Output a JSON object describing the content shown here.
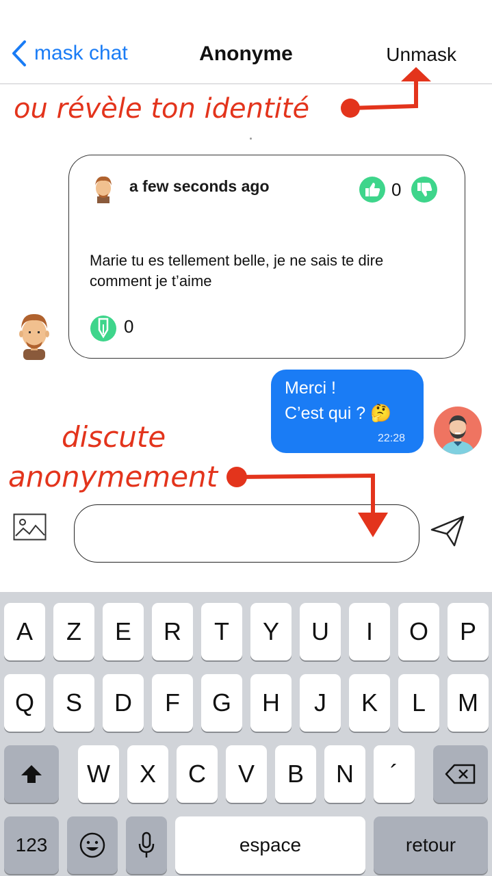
{
  "nav": {
    "back_label": "mask chat",
    "title": "Anonyme",
    "action_label": "Unmask"
  },
  "annotations": {
    "reveal": "ou révèle ton identité",
    "discuss_line1": "discute",
    "discuss_line2": "anonymement"
  },
  "post": {
    "time": "a few seconds ago",
    "text": "Marie tu es tellement belle, je ne sais te dire comment je t’aime",
    "votes": "0",
    "replies": "0"
  },
  "message": {
    "line1": "Merci !",
    "line2": "C’est qui ? 🤔",
    "time": "22:28"
  },
  "composer": {
    "value": ""
  },
  "keyboard": {
    "row1": [
      "A",
      "Z",
      "E",
      "R",
      "T",
      "Y",
      "U",
      "I",
      "O",
      "P"
    ],
    "row2": [
      "Q",
      "S",
      "D",
      "F",
      "G",
      "H",
      "J",
      "K",
      "L",
      "M"
    ],
    "row3": [
      "W",
      "X",
      "C",
      "V",
      "B",
      "N",
      "´"
    ],
    "numbers_label": "123",
    "space_label": "espace",
    "return_label": "retour"
  },
  "colors": {
    "accent": "#1a7cf5",
    "annotation": "#e3341c",
    "vote_green": "#3ed58b"
  },
  "icons": [
    "chevron-left-icon",
    "avatar-male-icon",
    "thumbs-up-icon",
    "thumbs-down-icon",
    "pen-icon",
    "image-icon",
    "send-icon",
    "shift-icon",
    "backspace-icon",
    "emoji-icon",
    "microphone-icon"
  ]
}
